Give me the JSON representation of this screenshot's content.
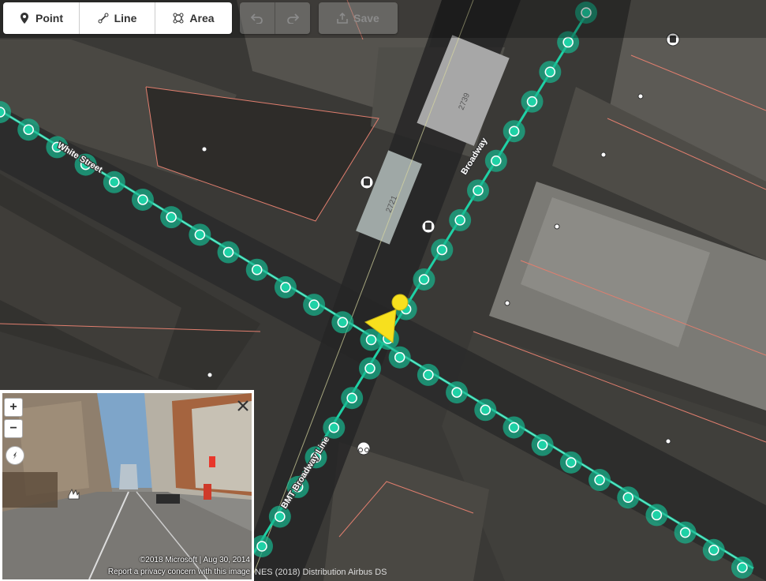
{
  "toolbar": {
    "point_label": "Point",
    "line_label": "Line",
    "area_label": "Area",
    "save_label": "Save"
  },
  "map_labels": {
    "white_street": "White Street",
    "broadway": "Broadway",
    "bmt_line": "BMT Broadway Line",
    "building_number_1": "2739",
    "building_number_2": "2721"
  },
  "photo": {
    "zoom_in": "+",
    "zoom_out": "−",
    "copyright": "©2018 Microsoft | Aug 30, 2014",
    "report": "Report a privacy concern with this image"
  },
  "attribution": "NES (2018) Distribution Airbus DS",
  "colors": {
    "node": "#1fd1a6",
    "node_halo": "#17b78f",
    "viewfield": "#f7e01e",
    "parcel": "#e07e6e",
    "toolbar_bg": "#ffffff"
  },
  "icons": [
    "point-icon",
    "line-icon",
    "area-icon",
    "undo-icon",
    "redo-icon",
    "save-icon",
    "close-icon",
    "compass-icon",
    "bus-icon",
    "bike-icon"
  ]
}
